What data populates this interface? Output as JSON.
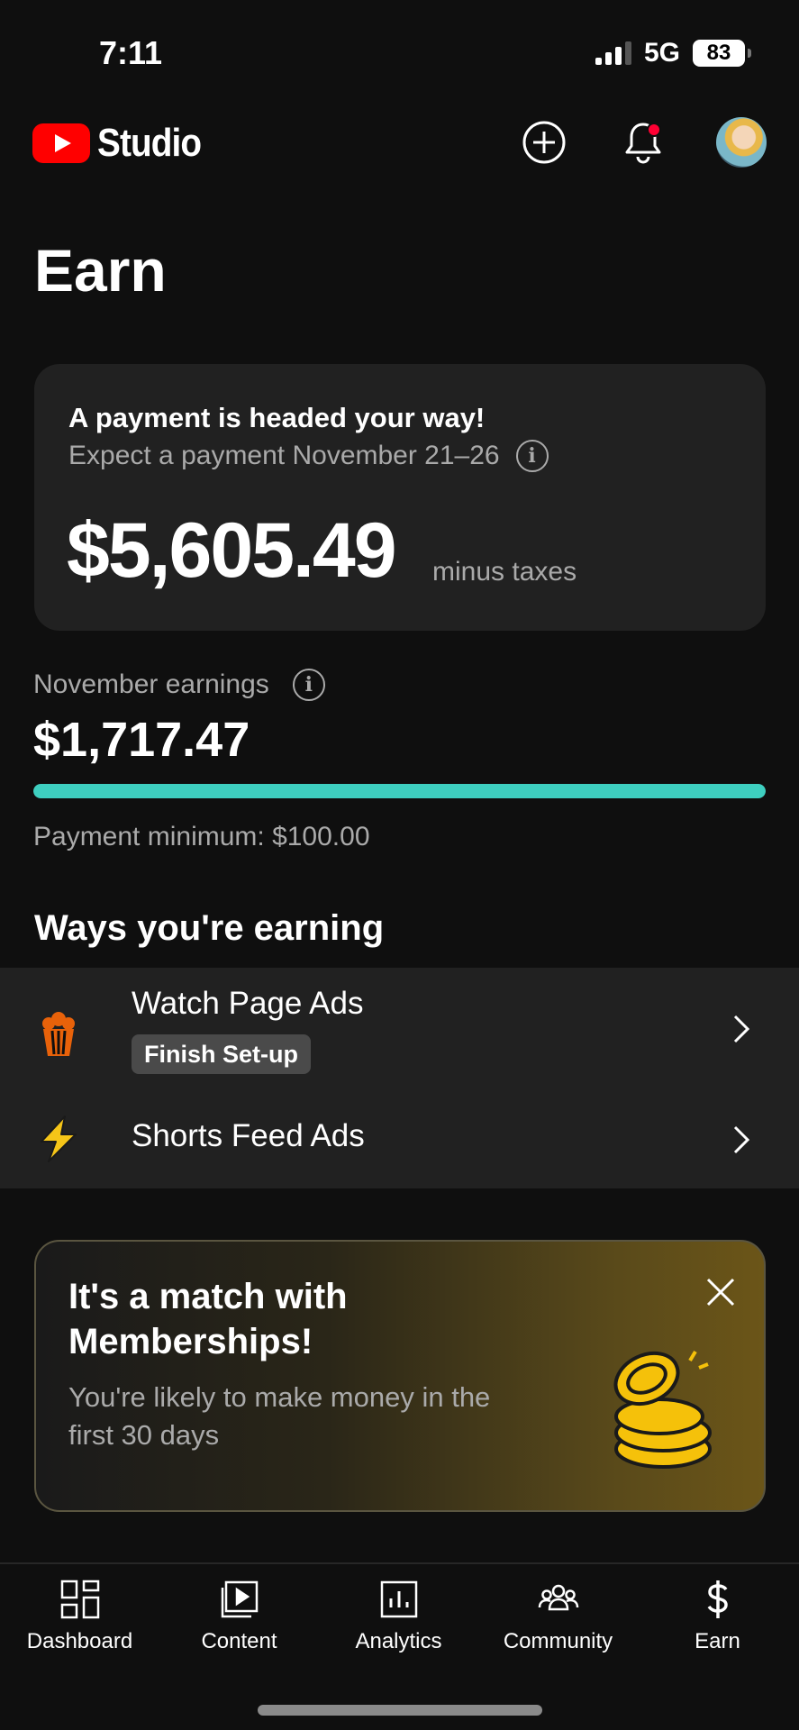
{
  "status_bar": {
    "time": "7:11",
    "network": "5G",
    "battery": "83"
  },
  "header": {
    "app_name": "Studio",
    "icons": [
      "create-icon",
      "notifications-icon",
      "avatar"
    ]
  },
  "page": {
    "title": "Earn"
  },
  "payment_card": {
    "headline": "A payment is headed your way!",
    "subtitle": "Expect a payment November 21–26",
    "amount": "$5,605.49",
    "suffix": "minus taxes"
  },
  "earnings": {
    "label": "November earnings",
    "amount": "$1,717.47",
    "progress": 1.0,
    "minimum_label": "Payment minimum: $100.00"
  },
  "ways": {
    "title": "Ways you're earning",
    "items": [
      {
        "name": "Watch Page Ads",
        "badge": "Finish Set-up",
        "icon": "popcorn-icon"
      },
      {
        "name": "Shorts Feed Ads",
        "icon": "lightning-icon"
      }
    ]
  },
  "promo": {
    "title": "It's a match with Memberships!",
    "description": "You're likely to make money in the first 30 days",
    "icon": "coins-icon"
  },
  "bottom_nav": {
    "items": [
      {
        "label": "Dashboard",
        "icon": "dashboard-icon"
      },
      {
        "label": "Content",
        "icon": "content-icon"
      },
      {
        "label": "Analytics",
        "icon": "analytics-icon"
      },
      {
        "label": "Community",
        "icon": "community-icon"
      },
      {
        "label": "Earn",
        "icon": "earn-icon"
      }
    ]
  },
  "colors": {
    "background": "#0f0f0f",
    "card": "#212121",
    "accent_progress": "#3ecfc0",
    "brand_red": "#ff0000",
    "popcorn_orange": "#e8620a",
    "lightning_yellow": "#f5c518",
    "coin_gold": "#f5c10a"
  }
}
